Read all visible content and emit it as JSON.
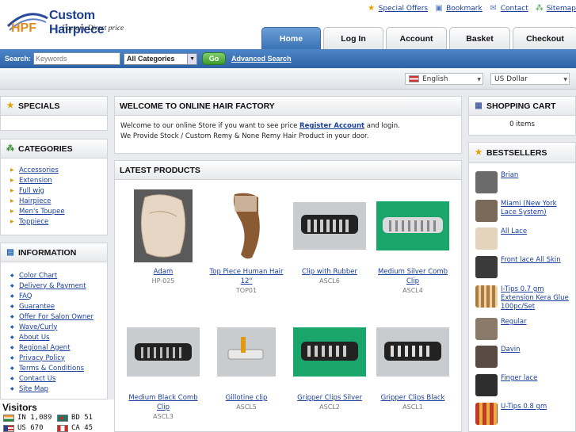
{
  "header": {
    "logo_mark": "HPF",
    "logo_name": "Custom Hairpiece",
    "logo_sub": "Factory Direct price",
    "top_links": [
      {
        "label": "Special Offers",
        "icon": "star-icon"
      },
      {
        "label": "Bookmark",
        "icon": "bookmark-icon"
      },
      {
        "label": "Contact",
        "icon": "envelope-icon"
      },
      {
        "label": "Sitemap",
        "icon": "sitemap-icon"
      }
    ],
    "tabs": [
      "Home",
      "Log In",
      "Account",
      "Basket",
      "Checkout"
    ],
    "active_tab": "Home"
  },
  "search": {
    "label": "Search:",
    "placeholder": "Keywords",
    "category": "All Categories",
    "go": "Go",
    "advanced": "Advanced Search"
  },
  "locale": {
    "language": "English",
    "currency": "US Dollar"
  },
  "left": {
    "specials_title": "SPECIALS",
    "categories_title": "CATEGORIES",
    "categories": [
      "Accessories",
      "Extension",
      "Full wig",
      "Hairpiece",
      "Men's Toupee",
      "Toppiece"
    ],
    "information_title": "INFORMATION",
    "information": [
      "Color Chart",
      "Delivery & Payment",
      "FAQ",
      "Guarantee",
      "Offer For Salon Owner",
      "Wave/Curly",
      "About Us",
      "Regional Agent",
      "Privacy Policy",
      "Terms & Conditions",
      "Contact Us",
      "Site Map"
    ],
    "visitors_title": "Visitors",
    "visitors": [
      {
        "cc": "IN",
        "count": "1,089"
      },
      {
        "cc": "BD",
        "count": "51"
      },
      {
        "cc": "US",
        "count": "670"
      },
      {
        "cc": "CA",
        "count": "45"
      }
    ]
  },
  "main": {
    "welcome_title": "WELCOME TO ONLINE HAIR FACTORY",
    "welcome_line1_pre": "Welcome to our  online Store if  you want to see price ",
    "welcome_link": "Register Account",
    "welcome_line1_post": " and login.",
    "welcome_line2": "We Provide Stock / Custom Remy & None Remy Hair Product in your door.",
    "latest_title": "LATEST PRODUCTS",
    "products": [
      {
        "name": "Adam",
        "code": "HP-025"
      },
      {
        "name": "Top Piece Human Hair 12\"",
        "code": "TOP01"
      },
      {
        "name": "Clip with Rubber",
        "code": "ASCL6"
      },
      {
        "name": "Medium Silver Comb Clip",
        "code": "ASCL4"
      },
      {
        "name": "Medium Black Comb Clip",
        "code": "ASCL3"
      },
      {
        "name": "Gillotine clip",
        "code": "ASCL5"
      },
      {
        "name": "Gripper Clips Silver",
        "code": "ASCL2"
      },
      {
        "name": "Gripper Clips Black",
        "code": "ASCL1"
      }
    ]
  },
  "right": {
    "cart_title": "SHOPPING CART",
    "cart_items": "0 items",
    "bestsellers_title": "BESTSELLERS",
    "bestsellers": [
      "Brian",
      "Miami (New York Lace System)",
      "All Lace",
      "Front lace All Skin",
      "I-Tips 0.7 gm Extension Kera Glue 100pc/Set",
      "Regular",
      "Davin",
      "Finger lace",
      "U-Tips 0.8 gm"
    ]
  }
}
